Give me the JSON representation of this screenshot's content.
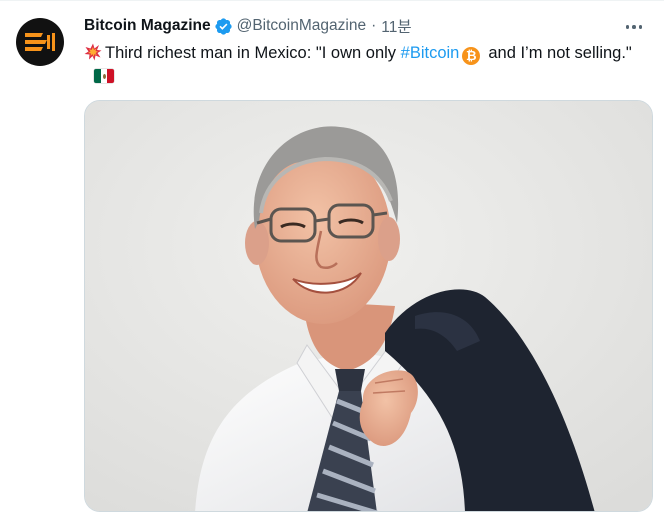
{
  "tweet": {
    "author": {
      "display_name": "Bitcoin Magazine",
      "handle": "@BitcoinMagazine",
      "verified": true,
      "avatar_icon": "bitcoin-magazine-logo-icon"
    },
    "separator": "·",
    "time": "11분",
    "text": {
      "lead_emoji": "collision-icon",
      "part1": "Third richest man in Mexico: \"I own only ",
      "hashtag": "#Bitcoin",
      "btc_glyph": "₿",
      "part2": "and I’m not selling.\"",
      "trailing_emoji": "mexico-flag-icon"
    },
    "media": {
      "kind": "photo"
    },
    "colors": {
      "link": "#1d9bf0",
      "secondary": "#536471",
      "verified": "#1d9bf0",
      "bitcoin": "#f7931a"
    }
  }
}
